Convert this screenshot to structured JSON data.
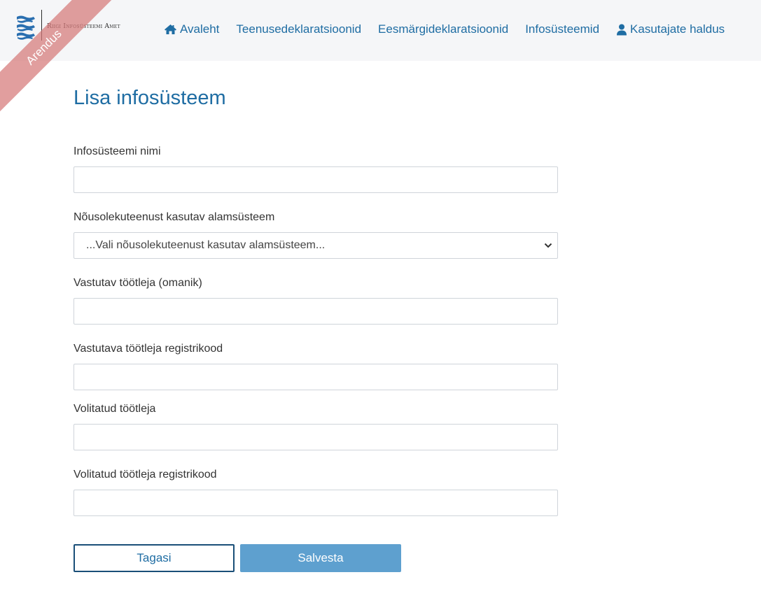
{
  "header": {
    "logo_text": "Riigi Infosüsteemi Amet",
    "environment_ribbon": "Arendus",
    "nav": [
      {
        "label": "Avaleht",
        "icon": "home-icon"
      },
      {
        "label": "Teenusedeklaratsioonid"
      },
      {
        "label": "Eesmärgideklaratsioonid"
      },
      {
        "label": "Infosüsteemid"
      },
      {
        "label": "Kasutajate haldus",
        "icon": "user-icon"
      }
    ]
  },
  "page": {
    "title": "Lisa infosüsteem"
  },
  "form": {
    "name_label": "Infosüsteemi nimi",
    "name_value": "",
    "subsystem_label": "Nõusolekuteenust kasutav alamsüsteem",
    "subsystem_selected": "...Vali nõusolekuteenust kasutav alamsüsteem...",
    "controller_label": "Vastutav töötleja (omanik)",
    "controller_value": "",
    "controller_code_label": "Vastutava töötleja registrikood",
    "controller_code_value": "",
    "processor_label": "Volitatud töötleja",
    "processor_value": "",
    "processor_code_label": "Volitatud töötleja registrikood",
    "processor_code_value": ""
  },
  "actions": {
    "back_label": "Tagasi",
    "save_label": "Salvesta"
  },
  "colors": {
    "accent": "#1f6da3",
    "header_bg": "#f5f6f8",
    "save_button": "#5ea0cf",
    "ribbon": "#d67878"
  }
}
